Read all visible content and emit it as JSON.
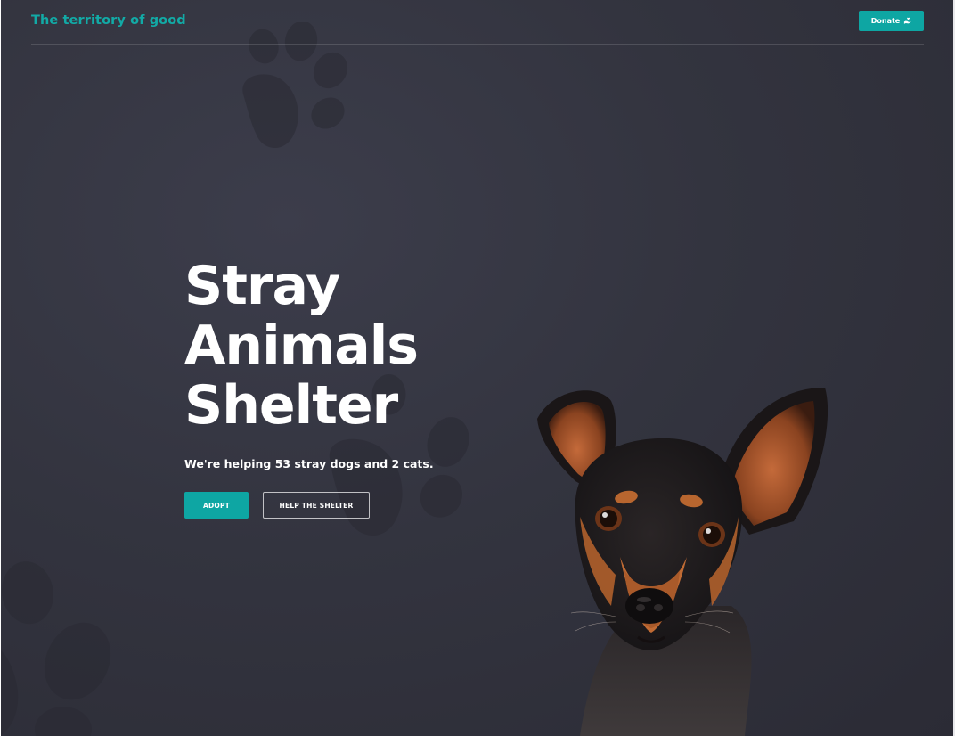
{
  "header": {
    "logo_text": "The territory of good",
    "donate_label": "Donate"
  },
  "hero": {
    "title_lines": [
      "Stray",
      "Animals",
      "Shelter"
    ],
    "subtitle": "We're helping 53 stray dogs and 2 cats.",
    "adopt_label": "ADOPT",
    "help_label": "HELP THE SHELTER"
  },
  "colors": {
    "accent": "#0ea6a3",
    "logo": "#12aaa6",
    "background": "#33343f",
    "text": "#ffffff"
  },
  "icons": {
    "donate": "hand-heart-icon",
    "background": "paw-print-icon"
  },
  "image": {
    "subject": "dog-photo"
  }
}
